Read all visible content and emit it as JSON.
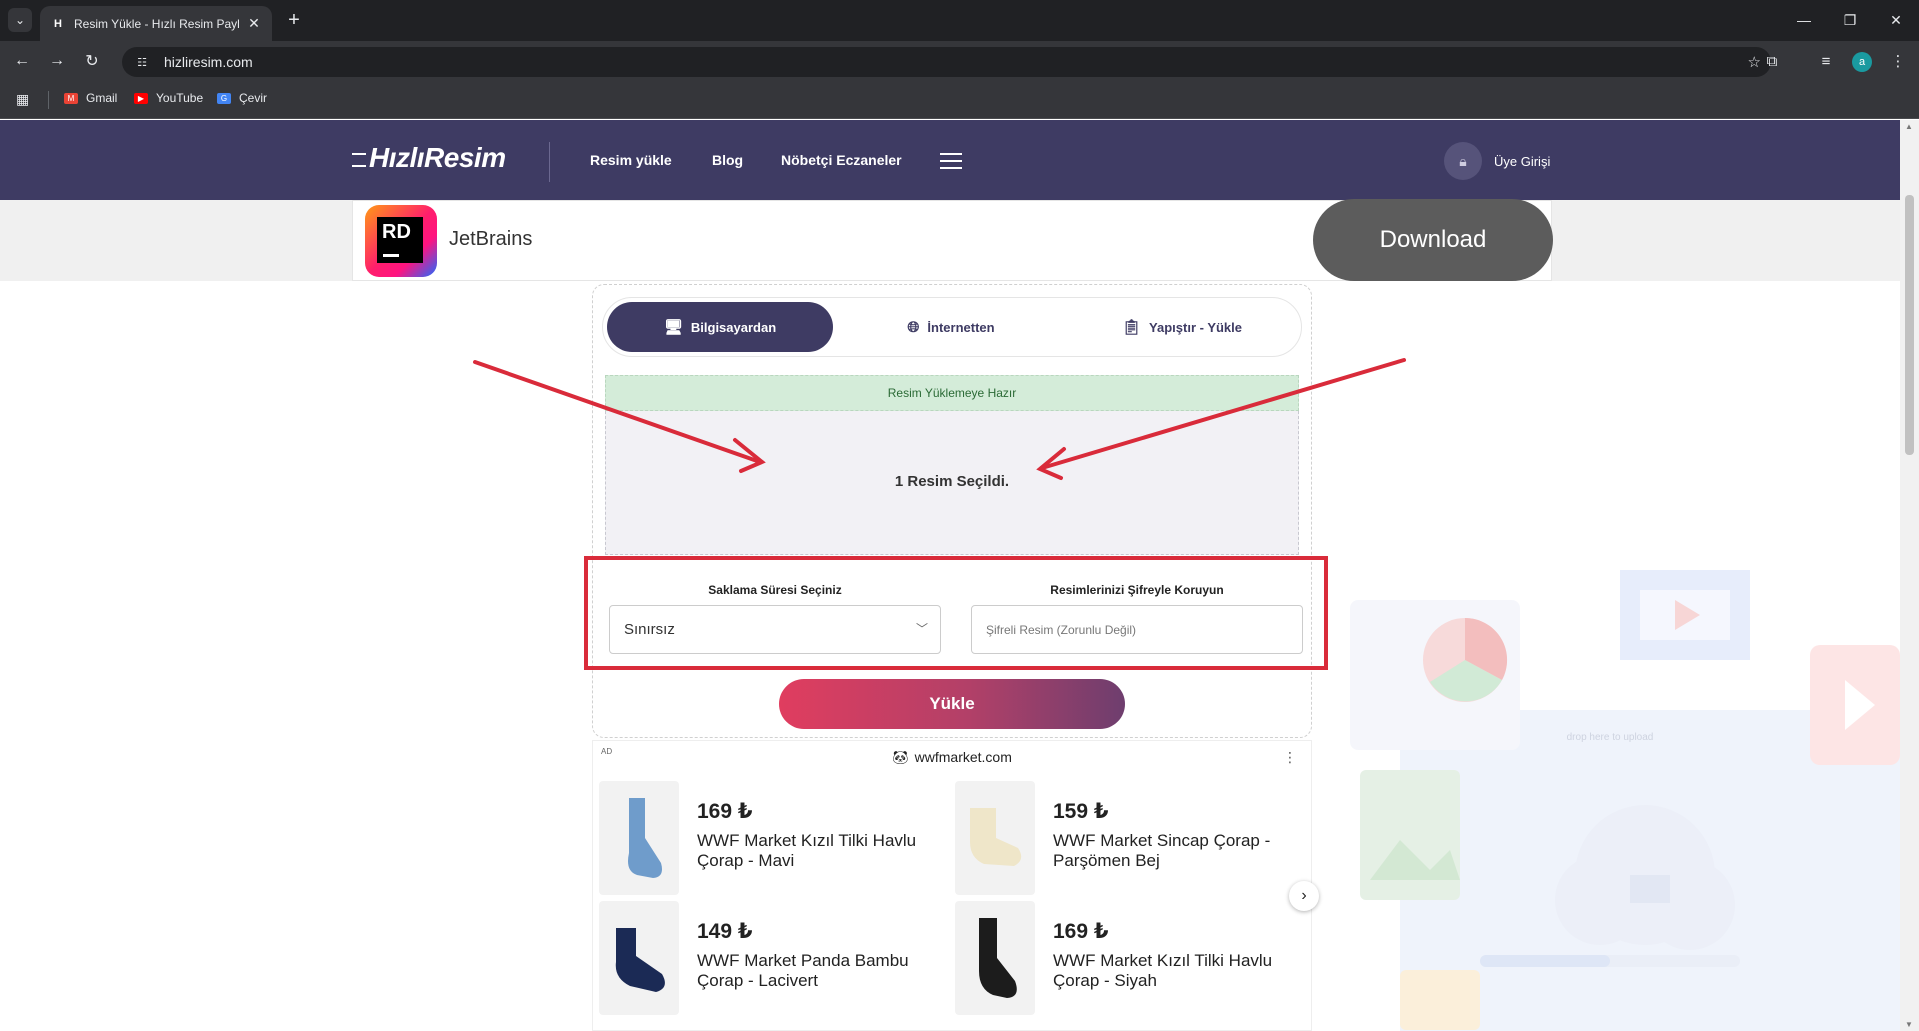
{
  "browser": {
    "tab_title": "Resim Yükle - Hızlı Resim Paylaş",
    "tab_favicon": "H",
    "url": "hizliresim.com",
    "profile_initial": "a",
    "bookmarks": [
      {
        "label": "Gmail",
        "color": "#ea4335"
      },
      {
        "label": "YouTube",
        "color": "#ff0000"
      },
      {
        "label": "Çevir",
        "color": "#4285f4"
      }
    ]
  },
  "header": {
    "logo": "HızlıResim",
    "nav": [
      "Resim yükle",
      "Blog",
      "Nöbetçi Eczaneler"
    ],
    "login": "Üye Girişi",
    "brand_color": "#3e3b63"
  },
  "ad_banner": {
    "logo_text": "RD",
    "brand": "JetBrains",
    "cta": "Download"
  },
  "upload": {
    "tabs": [
      "Bilgisayardan",
      "İnternetten",
      "Yapıştır - Yükle"
    ],
    "active_tab": 0,
    "status": "Resim Yüklemeye Hazır",
    "selected_msg": "1 Resim Seçildi.",
    "storage_label": "Saklama Süresi Seçiniz",
    "storage_value": "Sınırsız",
    "password_label": "Resimlerinizi Şifreyle Koruyun",
    "password_placeholder": "Şifreli Resim (Zorunlu Değil)",
    "submit": "Yükle",
    "background_hint": "drop here to upload"
  },
  "product_ad": {
    "tag": "AD",
    "domain": "wwfmarket.com",
    "products": [
      {
        "price": "169 ₺",
        "name": "WWF Market Kızıl Tilki Havlu Çorap - Mavi",
        "sock_color": "#6f9ccb"
      },
      {
        "price": "159 ₺",
        "name": "WWF Market Sincap Çorap - Parşömen Bej",
        "sock_color": "#efe6c9"
      },
      {
        "price": "149 ₺",
        "name": "WWF Market Panda Bambu Çorap - Lacivert",
        "sock_color": "#1b2a55"
      },
      {
        "price": "169 ₺",
        "name": "WWF Market Kızıl Tilki Havlu Çorap - Siyah",
        "sock_color": "#1c1c1c"
      }
    ]
  },
  "annotation_color": "#d92b3a"
}
